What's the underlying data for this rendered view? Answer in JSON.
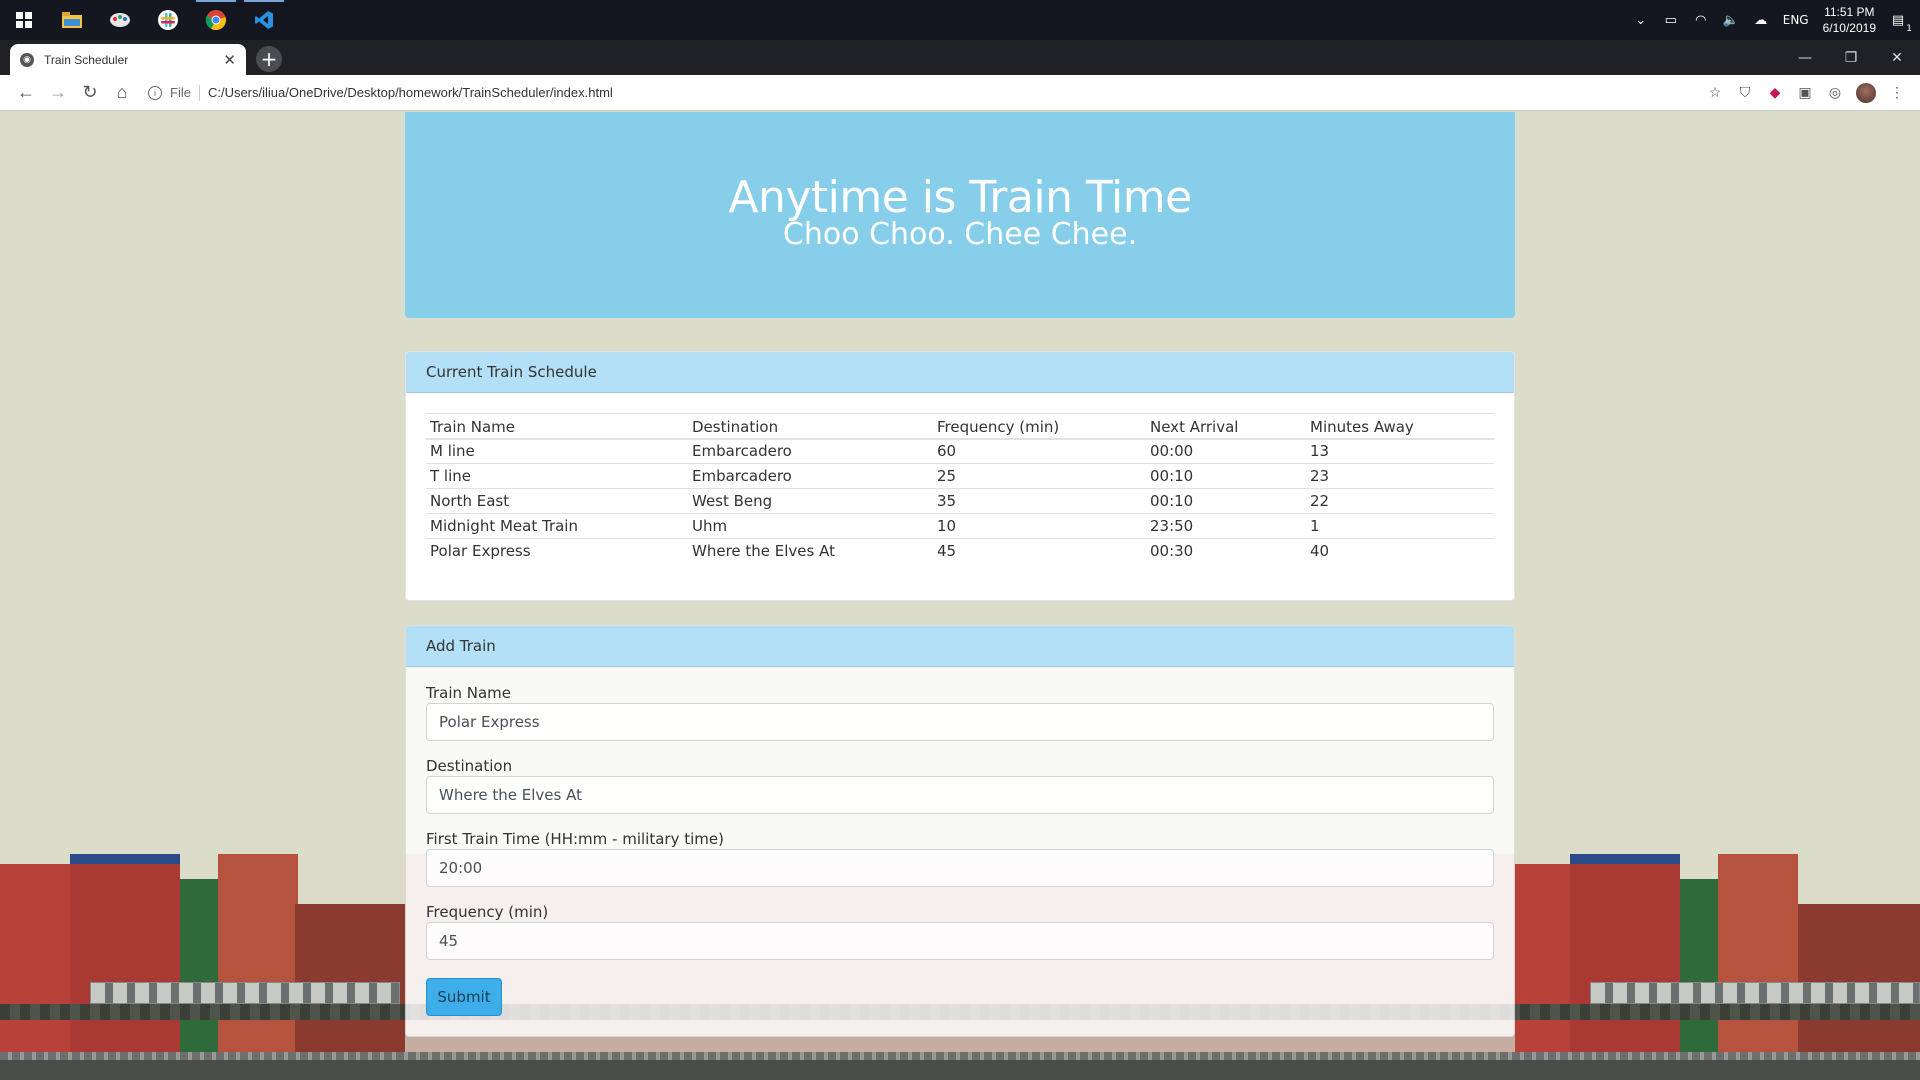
{
  "os": {
    "taskbar_apps": [
      {
        "name": "windows-start-icon"
      },
      {
        "name": "file-explorer-icon"
      },
      {
        "name": "paint-app-icon"
      },
      {
        "name": "slack-icon"
      },
      {
        "name": "chrome-icon"
      },
      {
        "name": "vscode-icon"
      }
    ],
    "language": "ENG",
    "time": "11:51 PM",
    "date": "6/10/2019",
    "notification_count": "1"
  },
  "browser": {
    "tab_title": "Train Scheduler",
    "scheme_label": "File",
    "url": "C:/Users/iliua/OneDrive/Desktop/homework/TrainScheduler/index.html"
  },
  "header": {
    "title": "Anytime is Train Time",
    "subtitle": "Choo Choo. Chee Chee."
  },
  "schedule": {
    "heading": "Current Train Schedule",
    "columns": [
      "Train Name",
      "Destination",
      "Frequency (min)",
      "Next Arrival",
      "Minutes Away"
    ],
    "rows": [
      [
        "M line",
        "Embarcadero",
        "60",
        "00:00",
        "13"
      ],
      [
        "T line",
        "Embarcadero",
        "25",
        "00:10",
        "23"
      ],
      [
        "North East",
        "West Beng",
        "35",
        "00:10",
        "22"
      ],
      [
        "Midnight Meat Train",
        "Uhm",
        "10",
        "23:50",
        "1"
      ],
      [
        "Polar Express",
        "Where the Elves At",
        "45",
        "00:30",
        "40"
      ]
    ]
  },
  "add_train": {
    "heading": "Add Train",
    "train_name_label": "Train Name",
    "train_name_value": "Polar Express",
    "destination_label": "Destination",
    "destination_value": "Where the Elves At",
    "first_time_label": "First Train Time (HH:mm - military time)",
    "first_time_value": "20:00",
    "frequency_label": "Frequency (min)",
    "frequency_value": "45",
    "submit_label": "Submit"
  },
  "colors": {
    "jumbotron": "#87ceeb",
    "card_header": "#b3e0f7",
    "submit_button": "#3daee9",
    "page_background": "#dcdccb"
  }
}
